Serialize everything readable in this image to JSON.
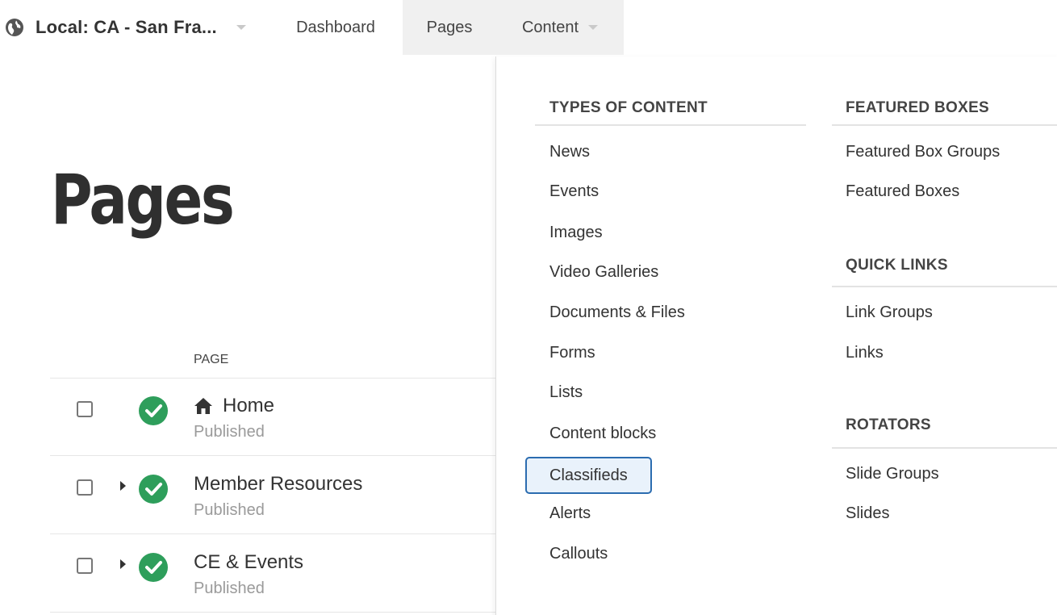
{
  "topbar": {
    "site_label": "Local: CA - San Fra...",
    "nav": [
      {
        "label": "Dashboard"
      },
      {
        "label": "Pages"
      },
      {
        "label": "Content"
      }
    ]
  },
  "page": {
    "title": "Pages",
    "column_header": "PAGE",
    "rows": [
      {
        "title": "Home",
        "status": "Published",
        "has_children": false,
        "icon": "home-icon"
      },
      {
        "title": "Member Resources",
        "status": "Published",
        "has_children": true
      },
      {
        "title": "CE & Events",
        "status": "Published",
        "has_children": true
      }
    ]
  },
  "content_menu": {
    "types_of_content": {
      "heading": "TYPES OF CONTENT",
      "items": [
        "News",
        "Events",
        "Images",
        "Video Galleries",
        "Documents & Files",
        "Forms",
        "Lists",
        "Content blocks",
        "Classifieds",
        "Alerts",
        "Callouts"
      ],
      "active": "Classifieds"
    },
    "featured_boxes": {
      "heading": "FEATURED BOXES",
      "items": [
        "Featured Box Groups",
        "Featured Boxes"
      ]
    },
    "quick_links": {
      "heading": "QUICK LINKS",
      "items": [
        "Link Groups",
        "Links"
      ]
    },
    "rotators": {
      "heading": "ROTATORS",
      "items": [
        "Slide Groups",
        "Slides"
      ]
    }
  },
  "colors": {
    "status_green": "#2e9e5b",
    "active_border": "#2b6cb0",
    "active_bg": "#e9f2fb"
  }
}
